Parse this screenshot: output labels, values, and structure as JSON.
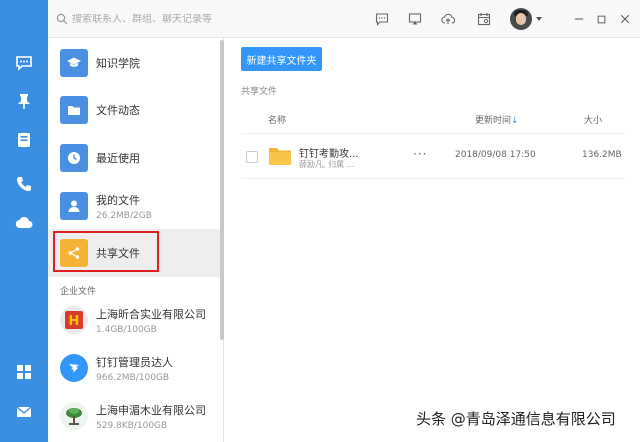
{
  "search": {
    "placeholder": "搜索联系人、群组、聊天记录等"
  },
  "nav": [
    {
      "label": "知识学院",
      "icon": "graduation-cap-icon",
      "color": "#4a90e2"
    },
    {
      "label": "文件动态",
      "icon": "folder-icon",
      "color": "#4a90e2"
    },
    {
      "label": "最近使用",
      "icon": "clock-icon",
      "color": "#4a90e2"
    },
    {
      "label": "我的文件",
      "sub": "26.2MB/2GB",
      "icon": "user-icon",
      "color": "#4a90e2"
    },
    {
      "label": "共享文件",
      "icon": "share-icon",
      "color": "#f5b335"
    }
  ],
  "section": {
    "enterprise": "企业文件"
  },
  "orgs": [
    {
      "label": "上海昕合实业有限公司",
      "sub": "1.4GB/100GB"
    },
    {
      "label": "钉钉管理员达人",
      "sub": "966.2MB/100GB"
    },
    {
      "label": "上海申湄木业有限公司",
      "sub": "529.8KB/100GB"
    }
  ],
  "main": {
    "new_folder": "新建共享文件夹",
    "crumb": "共享文件",
    "columns": {
      "name": "名称",
      "updated": "更新时间",
      "size": "大小"
    },
    "files": [
      {
        "name": "钉钉考勤攻...",
        "owner": "薛励凡, 归属 ...",
        "more": "···",
        "updated": "2018/09/08 17:50",
        "size": "136.2MB"
      }
    ]
  },
  "watermark": "头条 @青岛泽通信息有限公司",
  "colors": {
    "accent": "#3296fa",
    "rail": "#3b8fe3",
    "share": "#f5b335",
    "highlight": "#e02020"
  }
}
